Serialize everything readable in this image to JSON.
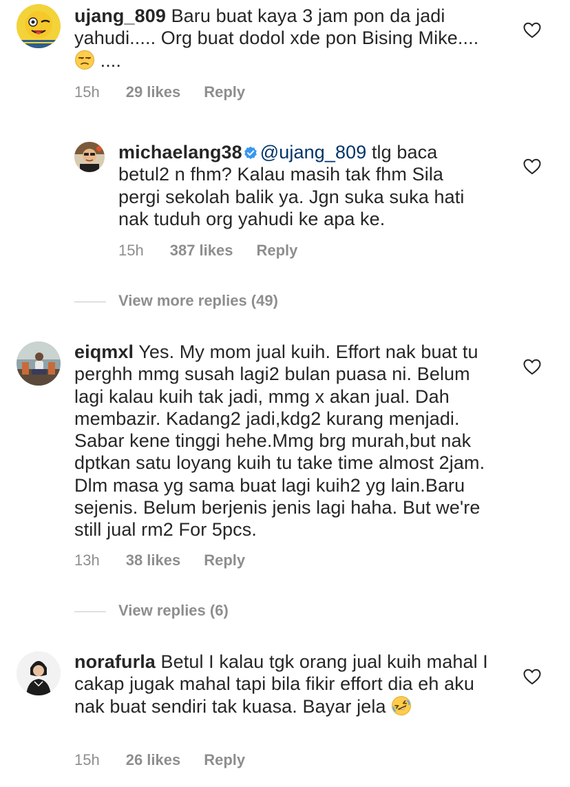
{
  "comments": [
    {
      "username": "ujang_809",
      "text": " Baru buat kaya 3 jam pon da jadi yahudi..... Org buat dodol xde pon Bising Mike.... ",
      "text_tail": " ....",
      "emoji": "unamused-face-emoji",
      "time": "15h",
      "likes": "29 likes",
      "reply": "Reply"
    },
    {
      "username": "eiqmxl",
      "text": " Yes. My mom jual kuih. Effort nak buat tu perghh mmg susah lagi2 bulan puasa ni. Belum lagi kalau kuih tak jadi, mmg x akan jual. Dah membazir. Kadang2 jadi,kdg2 kurang menjadi. Sabar kene tinggi hehe.Mmg brg murah,but nak dptkan satu loyang kuih tu take time almost 2jam. Dlm masa yg sama buat lagi kuih2 yg lain.Baru sejenis. Belum berjenis jenis lagi haha. But we're still jual rm2 For 5pcs.",
      "time": "13h",
      "likes": "38 likes",
      "reply": "Reply"
    },
    {
      "username": "norafurla",
      "text": " Betul I kalau tgk orang jual kuih mahal I cakap jugak mahal tapi bila fikir effort dia eh aku nak buat sendiri tak kuasa. Bayar jela ",
      "emoji": "rolling-on-floor-laughing-emoji",
      "time": "15h",
      "likes": "26 likes",
      "reply": "Reply"
    }
  ],
  "reply": {
    "username": "michaelang38",
    "verified": true,
    "mention": "@ujang_809",
    "text": " tlg baca betul2 n fhm? Kalau masih tak fhm Sila pergi sekolah balik ya. Jgn suka suka hati nak tuduh org yahudi ke apa ke.",
    "time": "15h",
    "likes": "387 likes",
    "reply": "Reply"
  },
  "view_more_replies": "View more replies (49)",
  "view_replies": "View replies (6)",
  "colors": {
    "text": "#262626",
    "secondary": "#8e8e8e",
    "mention": "#003569",
    "verified": "#3897f0",
    "divider": "#c7c7c7"
  },
  "icons": {
    "like": "heart-outline-icon",
    "verified": "verified-badge-icon"
  }
}
